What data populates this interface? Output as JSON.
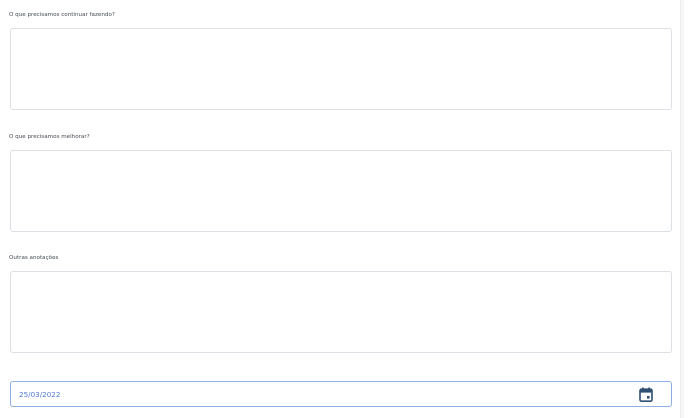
{
  "form": {
    "fields": [
      {
        "label": "O que precisamos continuar fazendo?",
        "value": ""
      },
      {
        "label": "O que precisamos melhorar?",
        "value": ""
      },
      {
        "label": "Outras anotações",
        "value": ""
      }
    ],
    "date": {
      "value": "25/03/2022",
      "icon": "calendar-icon"
    }
  },
  "colors": {
    "label_text": "#444a52",
    "border": "#dcdfe3",
    "date_border": "#8fb0e3",
    "date_text": "#4f7bd0",
    "icon": "#2f4f73"
  }
}
